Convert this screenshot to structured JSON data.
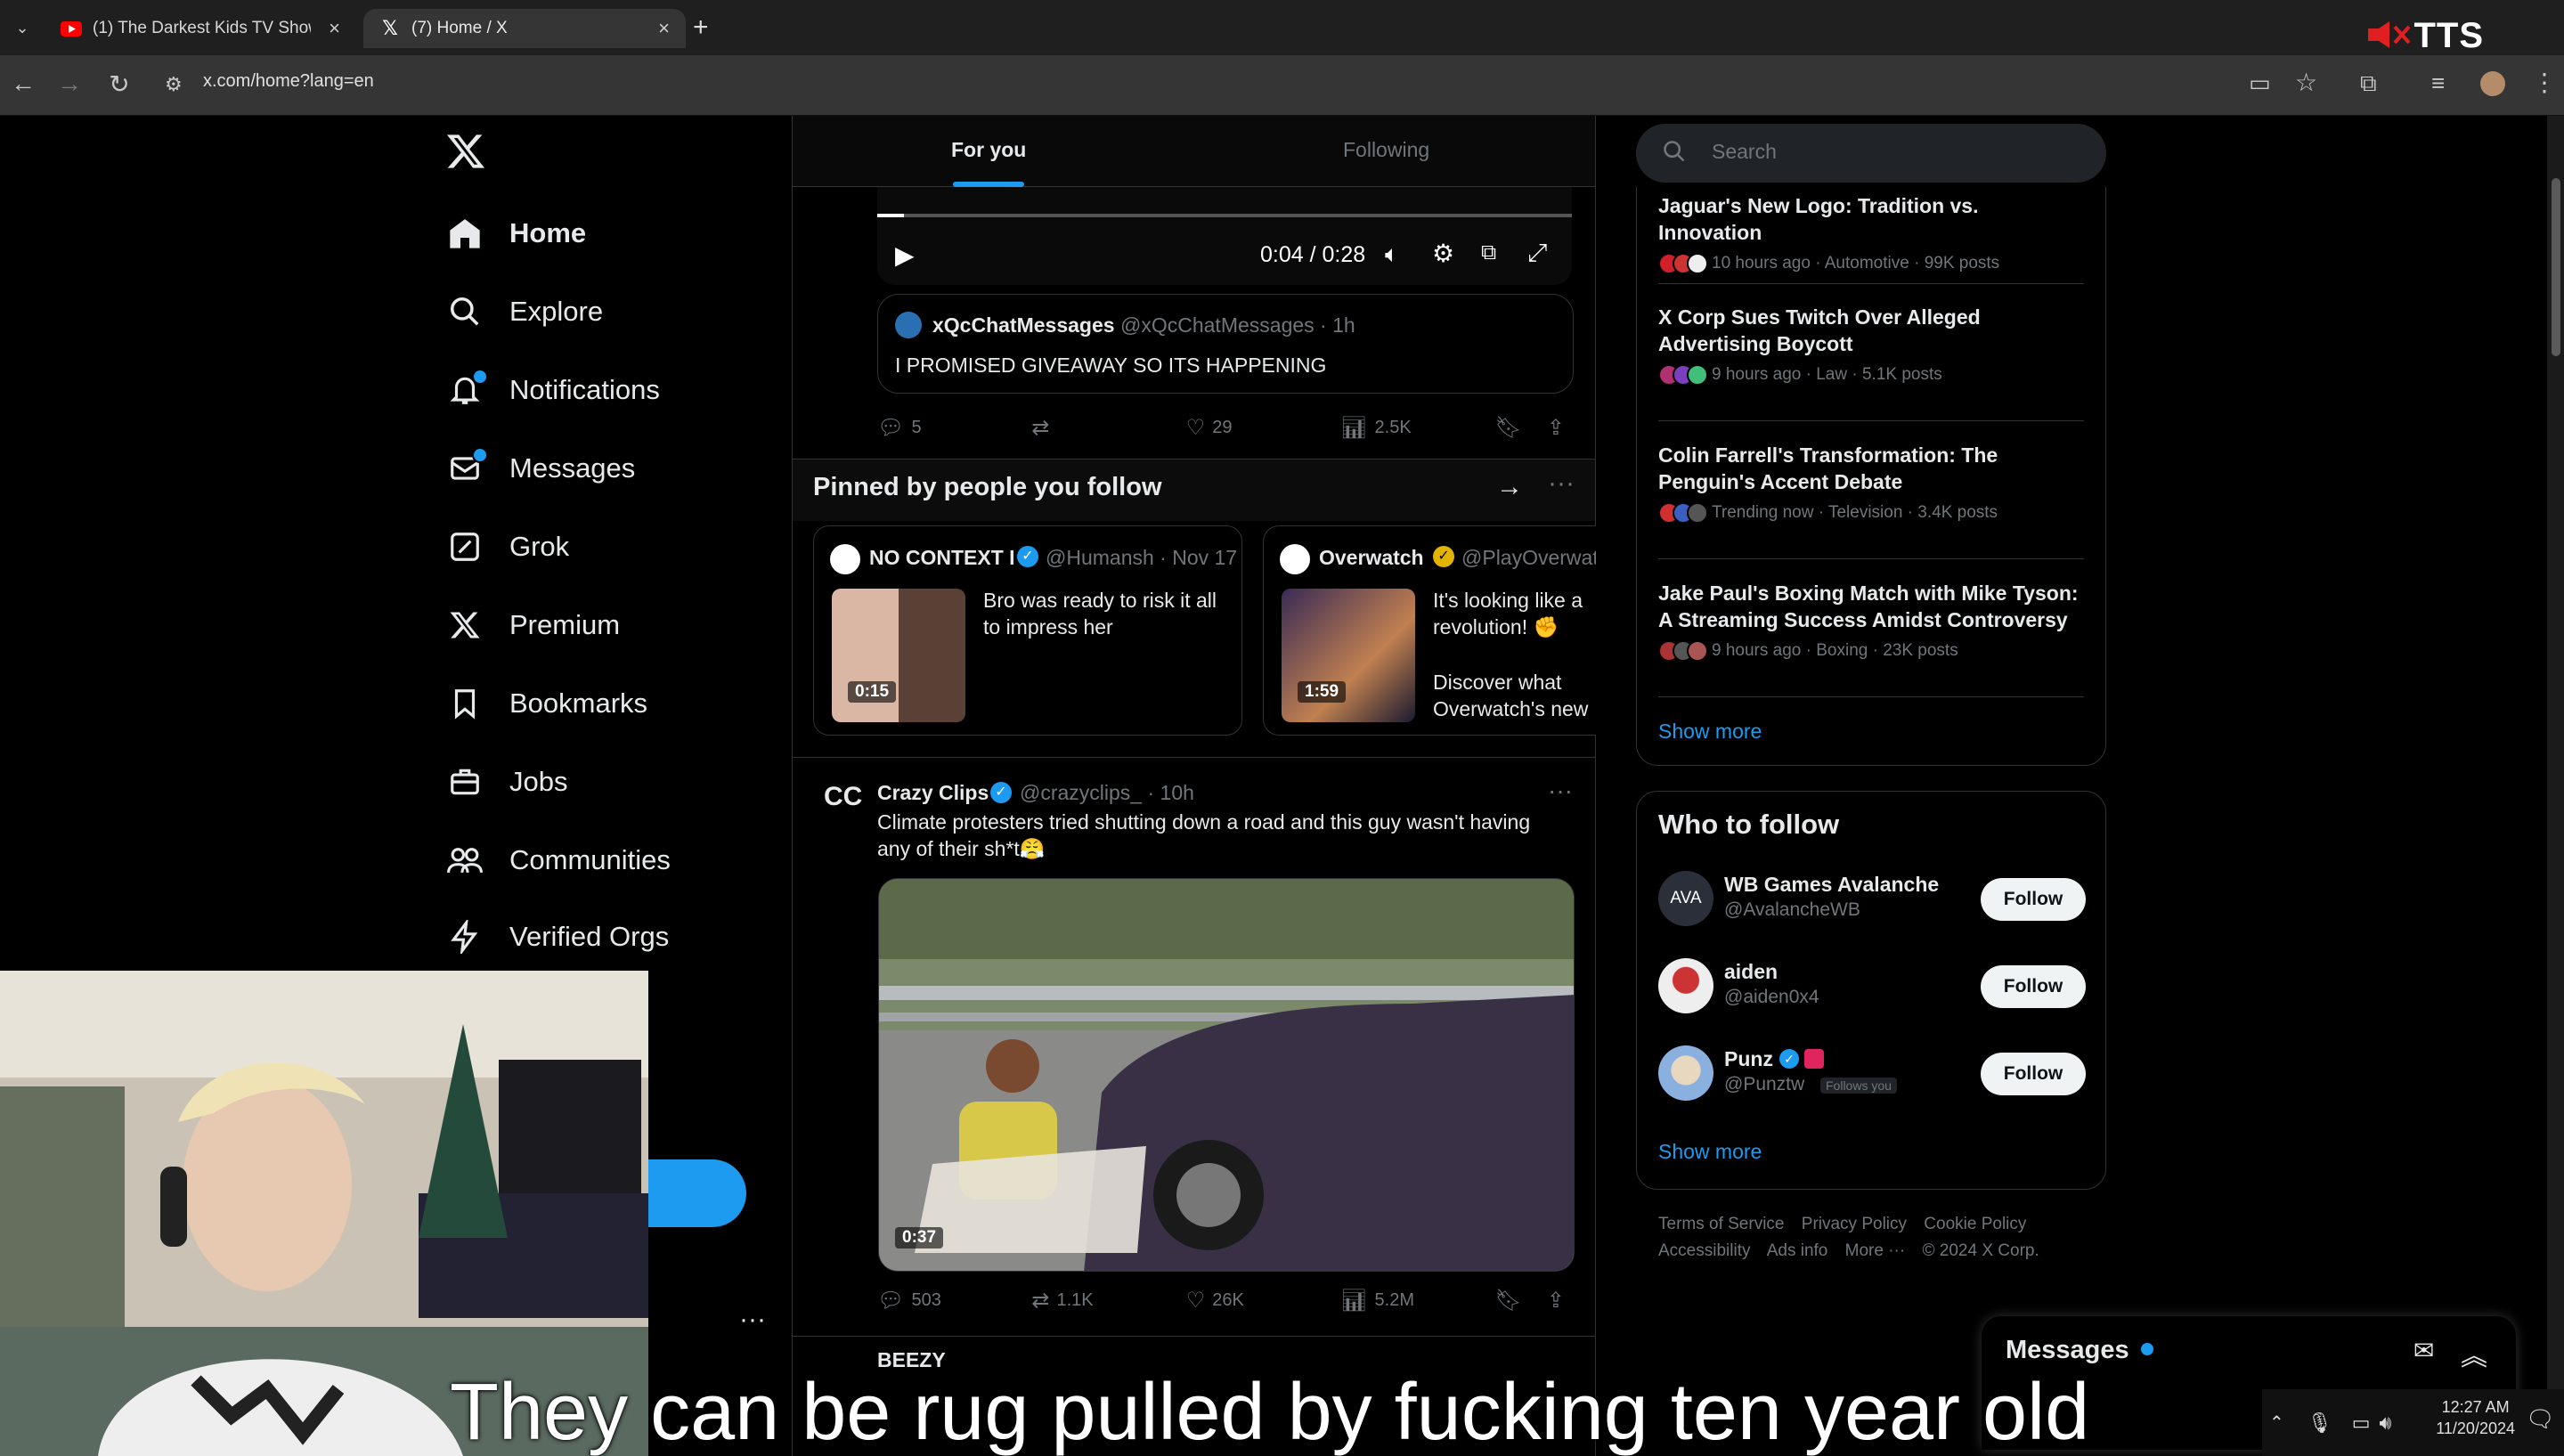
{
  "browser": {
    "tabs": [
      {
        "title": "(1) The Darkest Kids TV Show E",
        "active": false
      },
      {
        "title": "(7) Home / X",
        "active": true
      }
    ],
    "url": "x.com/home?lang=en",
    "overlay_label": "TTS"
  },
  "nav": {
    "items": [
      {
        "label": "Home",
        "icon": "home-icon"
      },
      {
        "label": "Explore",
        "icon": "search-icon"
      },
      {
        "label": "Notifications",
        "icon": "bell-icon"
      },
      {
        "label": "Messages",
        "icon": "mail-icon"
      },
      {
        "label": "Grok",
        "icon": "grok-icon"
      },
      {
        "label": "Premium",
        "icon": "x-icon"
      },
      {
        "label": "Bookmarks",
        "icon": "bookmark-icon"
      },
      {
        "label": "Jobs",
        "icon": "briefcase-icon"
      },
      {
        "label": "Communities",
        "icon": "people-icon"
      },
      {
        "label": "Verified Orgs",
        "icon": "bolt-icon"
      }
    ],
    "more": "···"
  },
  "timeline": {
    "tabs": {
      "for_you": "For you",
      "following": "Following"
    },
    "video": {
      "time": "0:04 / 0:28"
    },
    "quote": {
      "name": "xQcChatMessages",
      "handle": "@xQcChatMessages · 1h",
      "text": "I PROMISED GIVEAWAY SO ITS HAPPENING"
    },
    "tweet1_actions": {
      "replies": "5",
      "likes": "29",
      "views": "2.5K"
    },
    "pinned": {
      "title": "Pinned by people you follow",
      "cards": [
        {
          "name": "NO CONTEXT I",
          "handle": "@Humansh · Nov 17",
          "text": "Bro was ready to risk it all to impress her",
          "duration": "0:15"
        },
        {
          "name": "Overwatch",
          "handle": "@PlayOverwat",
          "text": "It's looking like a revolution! ✊",
          "text2": "Discover what Overwatch's new",
          "duration": "1:59"
        }
      ]
    },
    "tweet2": {
      "name": "Crazy Clips",
      "handle": "@crazyclips_ · 10h",
      "text": "Climate protesters tried shutting down a road and this guy wasn't having any of their sh*t😤",
      "duration": "0:37",
      "replies": "503",
      "reposts": "1.1K",
      "likes": "26K",
      "views": "5.2M"
    },
    "next_tweet_name": "BEEZY"
  },
  "sidebar": {
    "search_placeholder": "Search",
    "trends": [
      {
        "title": "Jaguar's New Logo: Tradition vs. Innovation",
        "meta": "10 hours ago · Automotive · 99K posts"
      },
      {
        "title": "X Corp Sues Twitch Over Alleged Advertising Boycott",
        "meta": "9 hours ago · Law · 5.1K posts"
      },
      {
        "title": "Colin Farrell's Transformation: The Penguin's Accent Debate",
        "meta": "Trending now · Television · 3.4K posts"
      },
      {
        "title": "Jake Paul's Boxing Match with Mike Tyson: A Streaming Success Amidst Controversy",
        "meta": "9 hours ago · Boxing · 23K posts"
      }
    ],
    "trends_show_more": "Show more",
    "who_to_follow": {
      "title": "Who to follow",
      "accounts": [
        {
          "name": "WB Games Avalanche",
          "handle": "@AvalancheWB",
          "avatar_text": "AVA",
          "button": "Follow"
        },
        {
          "name": "aiden",
          "handle": "@aiden0x4",
          "avatar_text": "",
          "button": "Follow"
        },
        {
          "name": "Punz",
          "handle": "@Punztw",
          "badge": "Follows you",
          "avatar_text": "",
          "button": "Follow"
        }
      ],
      "show_more": "Show more"
    },
    "footer": {
      "line1": [
        "Terms of Service",
        "Privacy Policy",
        "Cookie Policy"
      ],
      "line2": [
        "Accessibility",
        "Ads info",
        "More ···",
        "© 2024 X Corp."
      ]
    }
  },
  "messages_dock": {
    "title": "Messages"
  },
  "subtitle": "They can be rug pulled by fucking ten year old",
  "taskbar": {
    "time": "12:27 AM",
    "date": "11/20/2024"
  },
  "colors": {
    "accent": "#1d9bf0",
    "background": "#000000",
    "border": "#2f3336",
    "muted": "#71767b"
  }
}
